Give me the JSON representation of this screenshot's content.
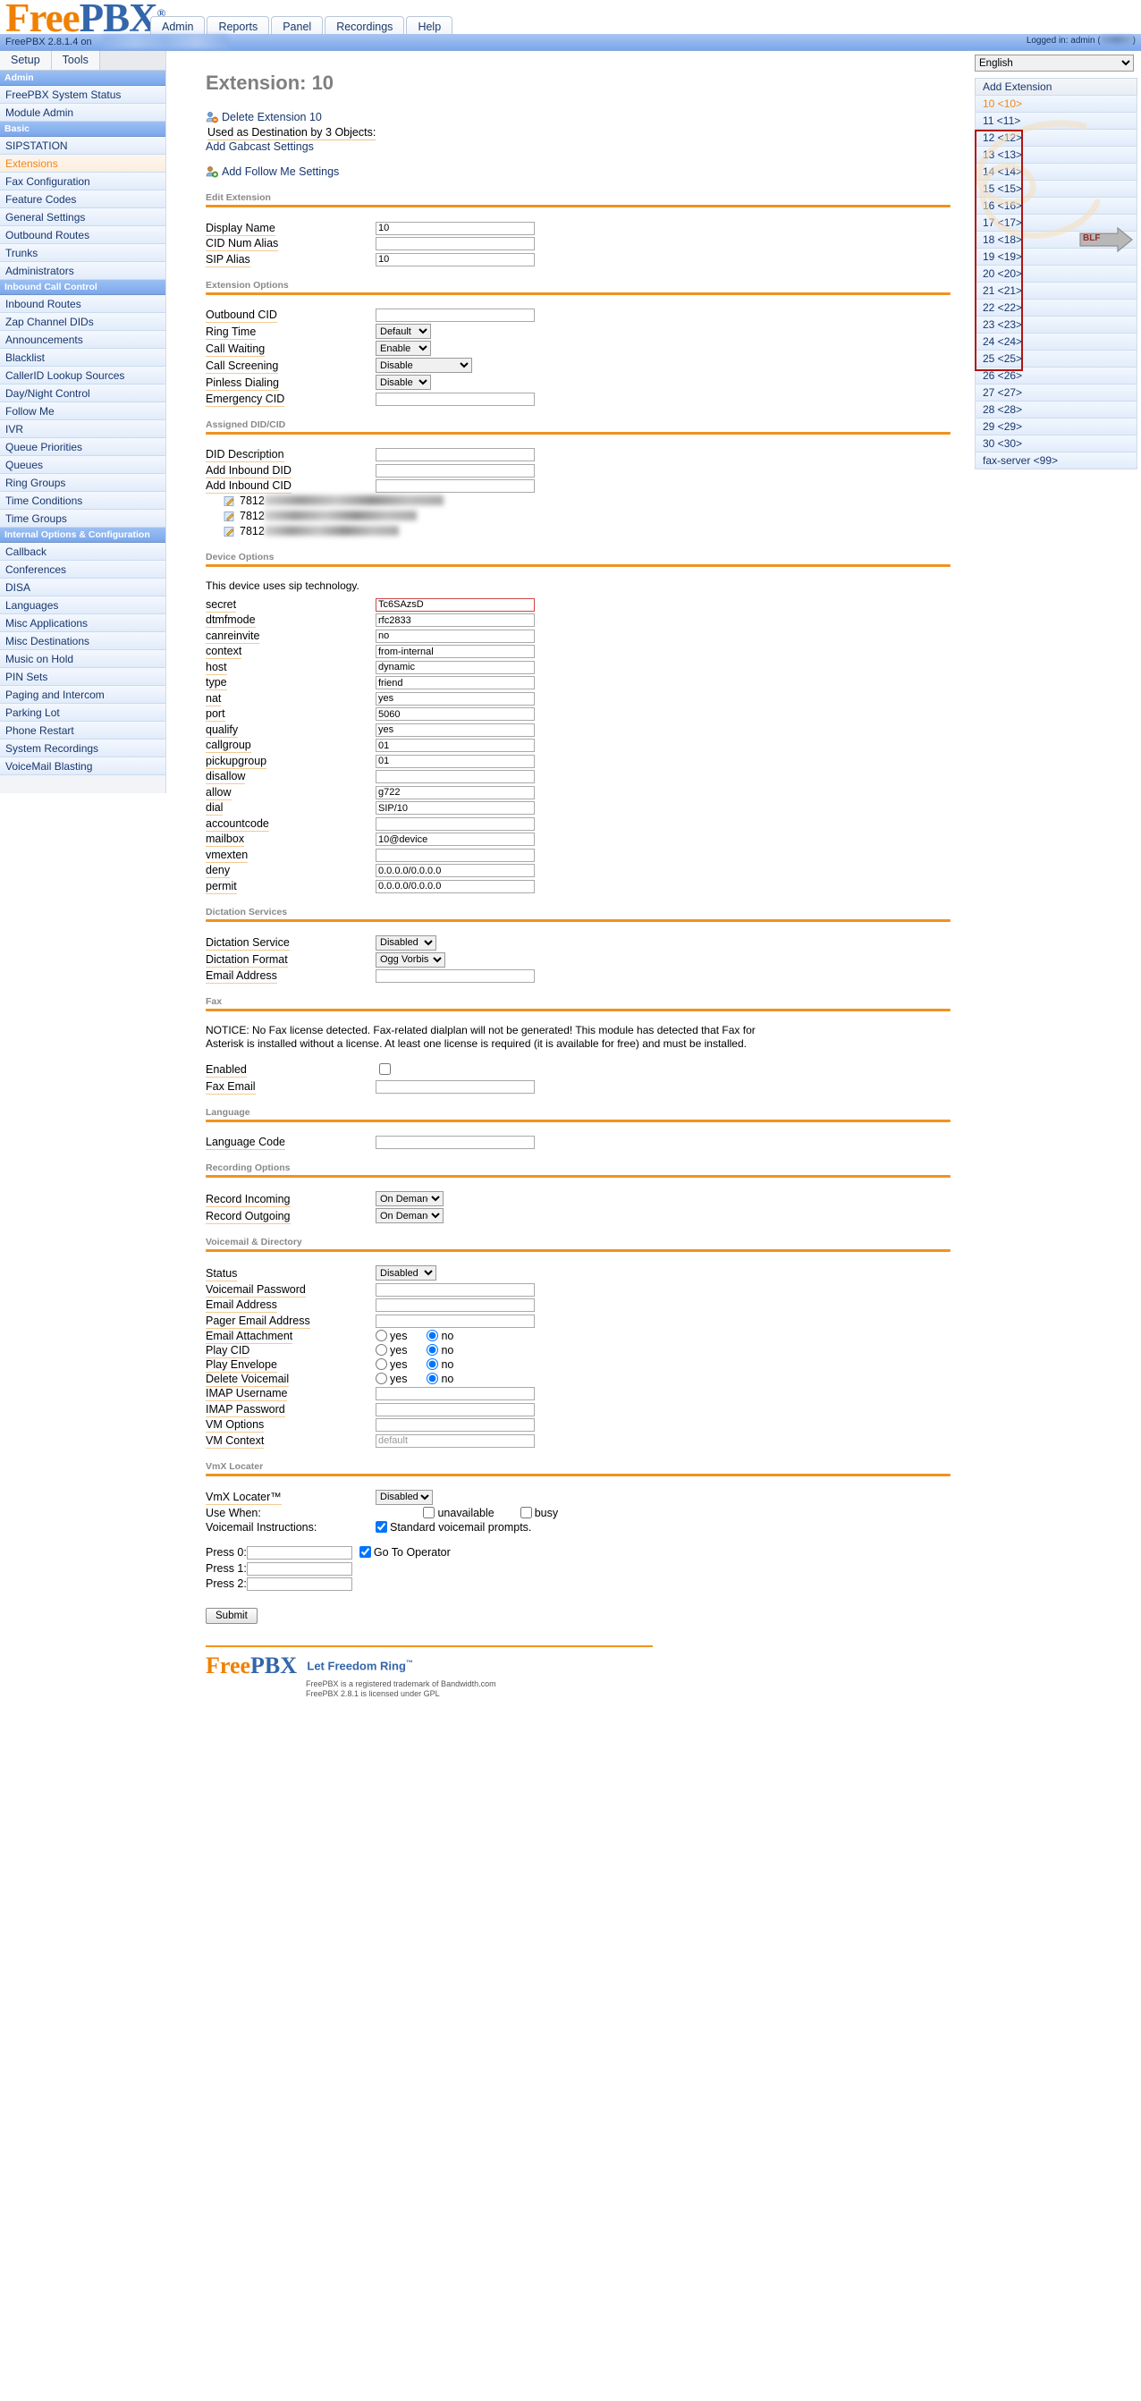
{
  "header": {
    "logo_free": "Free",
    "logo_pbx": "PBX",
    "logo_reg": "®",
    "nav_tabs": [
      "Admin",
      "Reports",
      "Panel",
      "Recordings",
      "Help"
    ],
    "version_text": "FreePBX 2.8.1.4 on",
    "logged_in_prefix": "Logged in: admin (",
    "logout_label": "Logout",
    "logged_in_suffix": ")"
  },
  "sidebar": {
    "tabs": [
      "Setup",
      "Tools"
    ],
    "groups": [
      {
        "header": "Admin",
        "items": [
          "FreePBX System Status",
          "Module Admin"
        ]
      },
      {
        "header": "Basic",
        "items": [
          "SIPSTATION",
          "Extensions",
          "Fax Configuration",
          "Feature Codes",
          "General Settings",
          "Outbound Routes",
          "Trunks",
          "Administrators"
        ]
      },
      {
        "header": "Inbound Call Control",
        "items": [
          "Inbound Routes",
          "Zap Channel DIDs",
          "Announcements",
          "Blacklist",
          "CallerID Lookup Sources",
          "Day/Night Control",
          "Follow Me",
          "IVR",
          "Queue Priorities",
          "Queues",
          "Ring Groups",
          "Time Conditions",
          "Time Groups"
        ]
      },
      {
        "header": "Internal Options & Configuration",
        "items": [
          "Callback",
          "Conferences",
          "DISA",
          "Languages",
          "Misc Applications",
          "Misc Destinations",
          "Music on Hold",
          "PIN Sets",
          "Paging and Intercom",
          "Parking Lot",
          "Phone Restart",
          "System Recordings",
          "VoiceMail Blasting"
        ]
      }
    ],
    "active_item": "Extensions"
  },
  "main": {
    "page_title": "Extension: 10",
    "delete_link": "Delete Extension 10",
    "used_as_destination": "Used as Destination by 3 Objects:",
    "add_gabcast": "Add Gabcast Settings",
    "add_follow_me": "Add Follow Me Settings",
    "sections": {
      "edit_extension": "Edit Extension",
      "extension_options": "Extension Options",
      "assigned_did_cid": "Assigned DID/CID",
      "device_options": "Device Options",
      "dictation_services": "Dictation Services",
      "fax": "Fax",
      "language": "Language",
      "recording_options": "Recording Options",
      "voicemail_directory": "Voicemail & Directory",
      "vmx_locater": "VmX Locater"
    },
    "edit_extension_fields": [
      {
        "label": "Display Name",
        "value": "10"
      },
      {
        "label": "CID Num Alias",
        "value": ""
      },
      {
        "label": "SIP Alias",
        "value": "10"
      }
    ],
    "extension_options_fields": [
      {
        "label": "Outbound CID",
        "type": "text",
        "value": ""
      },
      {
        "label": "Ring Time",
        "type": "select",
        "value": "Default"
      },
      {
        "label": "Call Waiting",
        "type": "select",
        "value": "Enable"
      },
      {
        "label": "Call Screening",
        "type": "select",
        "value": "Disable"
      },
      {
        "label": "Pinless Dialing",
        "type": "select",
        "value": "Disable"
      },
      {
        "label": "Emergency CID",
        "type": "text",
        "value": ""
      }
    ],
    "did_fields": [
      {
        "label": "DID Description",
        "value": ""
      },
      {
        "label": "Add Inbound DID",
        "value": ""
      },
      {
        "label": "Add Inbound CID",
        "value": ""
      }
    ],
    "did_entries": [
      {
        "prefix": "7812",
        "redacted": true
      },
      {
        "prefix": "7812",
        "redacted": true
      },
      {
        "prefix": "7812",
        "redacted": true
      }
    ],
    "device_tech_note": "This device uses sip technology.",
    "device_fields": [
      {
        "label": "secret",
        "value": "Tc6SAzsD",
        "highlight": true
      },
      {
        "label": "dtmfmode",
        "value": "rfc2833"
      },
      {
        "label": "canreinvite",
        "value": "no"
      },
      {
        "label": "context",
        "value": "from-internal"
      },
      {
        "label": "host",
        "value": "dynamic"
      },
      {
        "label": "type",
        "value": "friend"
      },
      {
        "label": "nat",
        "value": "yes"
      },
      {
        "label": "port",
        "value": "5060"
      },
      {
        "label": "qualify",
        "value": "yes"
      },
      {
        "label": "callgroup",
        "value": "01"
      },
      {
        "label": "pickupgroup",
        "value": "01"
      },
      {
        "label": "disallow",
        "value": ""
      },
      {
        "label": "allow",
        "value": "g722"
      },
      {
        "label": "dial",
        "value": "SIP/10"
      },
      {
        "label": "accountcode",
        "value": ""
      },
      {
        "label": "mailbox",
        "value": "10@device"
      },
      {
        "label": "vmexten",
        "value": ""
      },
      {
        "label": "deny",
        "value": "0.0.0.0/0.0.0.0"
      },
      {
        "label": "permit",
        "value": "0.0.0.0/0.0.0.0"
      }
    ],
    "dictation_fields": [
      {
        "label": "Dictation Service",
        "type": "select",
        "value": "Disabled"
      },
      {
        "label": "Dictation Format",
        "type": "select",
        "value": "Ogg Vorbis"
      },
      {
        "label": "Email Address",
        "type": "text",
        "value": ""
      }
    ],
    "fax_notice": "NOTICE: No Fax license detected. Fax-related dialplan will not be generated! This module has detected that Fax for Asterisk is installed without a license. At least one license is required (it is available for free) and must be installed.",
    "fax_enabled_label": "Enabled",
    "fax_email_label": "Fax Email",
    "fax_email_value": "",
    "language_code_label": "Language Code",
    "language_code_value": "",
    "recording_fields": [
      {
        "label": "Record Incoming",
        "value": "On Demand"
      },
      {
        "label": "Record Outgoing",
        "value": "On Demand"
      }
    ],
    "voicemail_status": {
      "label": "Status",
      "value": "Disabled"
    },
    "voicemail_text_fields": [
      {
        "label": "Voicemail Password",
        "value": ""
      },
      {
        "label": "Email Address",
        "value": ""
      },
      {
        "label": "Pager Email Address",
        "value": ""
      }
    ],
    "voicemail_radio_fields": [
      {
        "label": "Email Attachment",
        "yes": "yes",
        "no": "no",
        "selected": "no"
      },
      {
        "label": "Play CID",
        "yes": "yes",
        "no": "no",
        "selected": "no"
      },
      {
        "label": "Play Envelope",
        "yes": "yes",
        "no": "no",
        "selected": "no"
      },
      {
        "label": "Delete Voicemail",
        "yes": "yes",
        "no": "no",
        "selected": "no"
      }
    ],
    "voicemail_tail_fields": [
      {
        "label": "IMAP Username",
        "value": ""
      },
      {
        "label": "IMAP Password",
        "value": ""
      },
      {
        "label": "VM Options",
        "value": ""
      },
      {
        "label": "VM Context",
        "value": "default",
        "placeholder_style": true
      }
    ],
    "vmx": {
      "locater_label": "VmX Locater™",
      "locater_value": "Disabled",
      "use_when_label": "Use When:",
      "use_when_options": [
        "unavailable",
        "busy"
      ],
      "voicemail_instructions_label": "Voicemail Instructions:",
      "standard_prompts_label": "Standard voicemail prompts.",
      "standard_prompts_checked": true,
      "press_rows": [
        {
          "label": "Press 0:",
          "value": "",
          "extra": "Go To Operator",
          "extra_checked": true
        },
        {
          "label": "Press 1:",
          "value": "",
          "extra": ""
        },
        {
          "label": "Press 2:",
          "value": "",
          "extra": ""
        }
      ]
    },
    "submit_label": "Submit"
  },
  "right_panel": {
    "language_selected": "English",
    "add_extension_label": "Add Extension",
    "extensions": [
      "10 <10>",
      "11 <11>",
      "12 <12>",
      "13 <13>",
      "14 <14>",
      "15 <15>",
      "16 <16>",
      "17 <17>",
      "18 <18>",
      "19 <19>",
      "20 <20>",
      "21 <21>",
      "22 <22>",
      "23 <23>",
      "24 <24>",
      "25 <25>",
      "26 <26>",
      "27 <27>",
      "28 <28>",
      "29 <29>",
      "30 <30>",
      "fax-server <99>"
    ],
    "current_extension": "10 <10>",
    "annotation_label": "BLF",
    "annotation_color": "#b01414"
  },
  "footer": {
    "logo_free": "Free",
    "logo_pbx": "PBX",
    "tagline": "Let Freedom Ring",
    "line1": "FreePBX is a registered trademark of Bandwidth.com",
    "line2": "FreePBX 2.8.1 is licensed under GPL"
  }
}
